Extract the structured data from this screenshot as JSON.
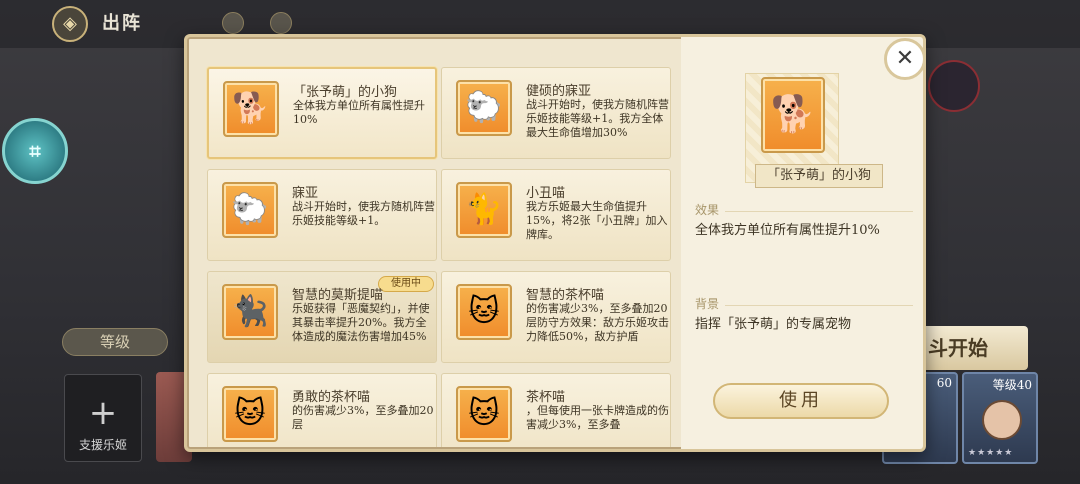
{
  "background": {
    "title": "出阵",
    "level_tab": "等级",
    "support_label": "支援乐姬",
    "start_button": "斗开始",
    "char_cards": [
      {
        "level": "60"
      },
      {
        "level": "等级40"
      }
    ]
  },
  "pets": [
    {
      "name": "「张予萌」的小狗",
      "desc": "全体我方单位所有属性提升10%",
      "glyph": "🐕",
      "selected": true
    },
    {
      "name": "健硕的寐亚",
      "desc": "战斗开始时，使我方随机阵营乐姬技能等级+1。我方全体最大生命值增加30%",
      "glyph": "🐑"
    },
    {
      "name": "寐亚",
      "desc": "战斗开始时，使我方随机阵营乐姬技能等级+1。",
      "glyph": "🐑"
    },
    {
      "name": "小丑喵",
      "desc": "我方乐姬最大生命值提升15%，将2张「小丑牌」加入牌库。",
      "glyph": "🐈"
    },
    {
      "name": "智慧的莫斯提喵",
      "desc": "乐姬获得「恶魔契约」，并使其暴击率提升20%。我方全体造成的魔法伤害增加45%",
      "glyph": "🐈‍⬛",
      "badge": "使用中"
    },
    {
      "name": "智慧的茶杯喵",
      "desc": "的伤害减少3%，至多叠加20层防守方效果：敌方乐姬攻击力降低50%，敌方护盾",
      "glyph": "🐱"
    },
    {
      "name": "勇敢的茶杯喵",
      "desc": "的伤害减少3%，至多叠加20层",
      "glyph": "🐱"
    },
    {
      "name": "茶杯喵",
      "desc": "，但每使用一张卡牌造成的伤害减少3%，至多叠",
      "glyph": "🐱"
    }
  ],
  "detail": {
    "name": "「张予萌」的小狗",
    "glyph": "🐕",
    "effect_label": "效果",
    "effect_text": "全体我方单位所有属性提升10%",
    "background_label": "背景",
    "background_text": "指挥「张予萌」的专属宠物",
    "use_button": "使用",
    "close_glyph": "✕"
  }
}
